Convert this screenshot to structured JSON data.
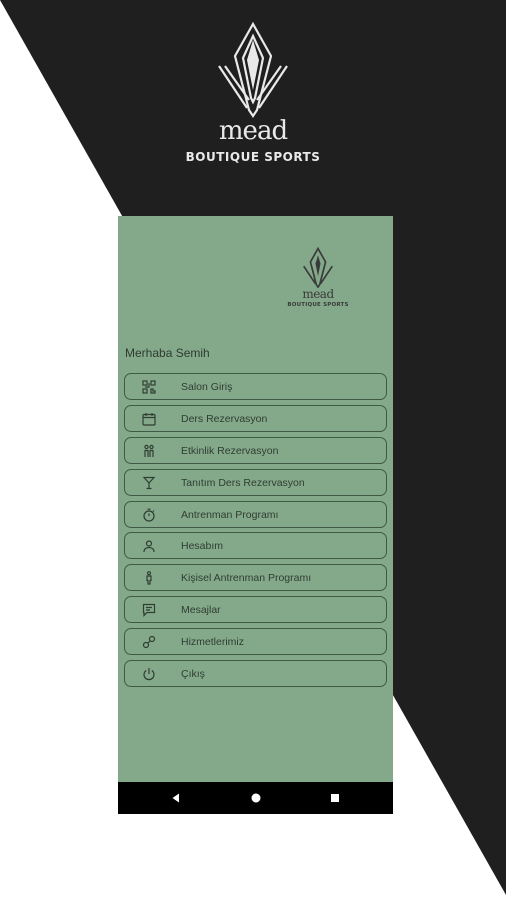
{
  "brand": {
    "wordmark": "mead",
    "tagline": "BOUTIQUE SPORTS"
  },
  "greeting": "Merhaba Semih",
  "menu": {
    "items": [
      {
        "label": "Salon Giriş",
        "icon": "qr-code-icon"
      },
      {
        "label": "Ders Rezervasyon",
        "icon": "calendar-icon"
      },
      {
        "label": "Etkinlik Rezervasyon",
        "icon": "people-icon"
      },
      {
        "label": "Tanıtım Ders Rezervasyon",
        "icon": "cocktail-glass-icon"
      },
      {
        "label": "Antrenman Programı",
        "icon": "timer-icon"
      },
      {
        "label": "Hesabım",
        "icon": "person-icon"
      },
      {
        "label": "Kişisel Antrenman Programı",
        "icon": "person-standing-icon"
      },
      {
        "label": "Mesajlar",
        "icon": "message-icon"
      },
      {
        "label": "Hizmetlerimiz",
        "icon": "services-icon"
      },
      {
        "label": "Çıkış",
        "icon": "power-icon"
      }
    ]
  },
  "navbar": {
    "buttons": [
      "back-button",
      "home-button",
      "recents-button"
    ]
  },
  "colors": {
    "dark_background": "#1f1f1f",
    "app_background": "#84a98a",
    "item_border": "#3f5a44",
    "navbar": "#000000"
  }
}
